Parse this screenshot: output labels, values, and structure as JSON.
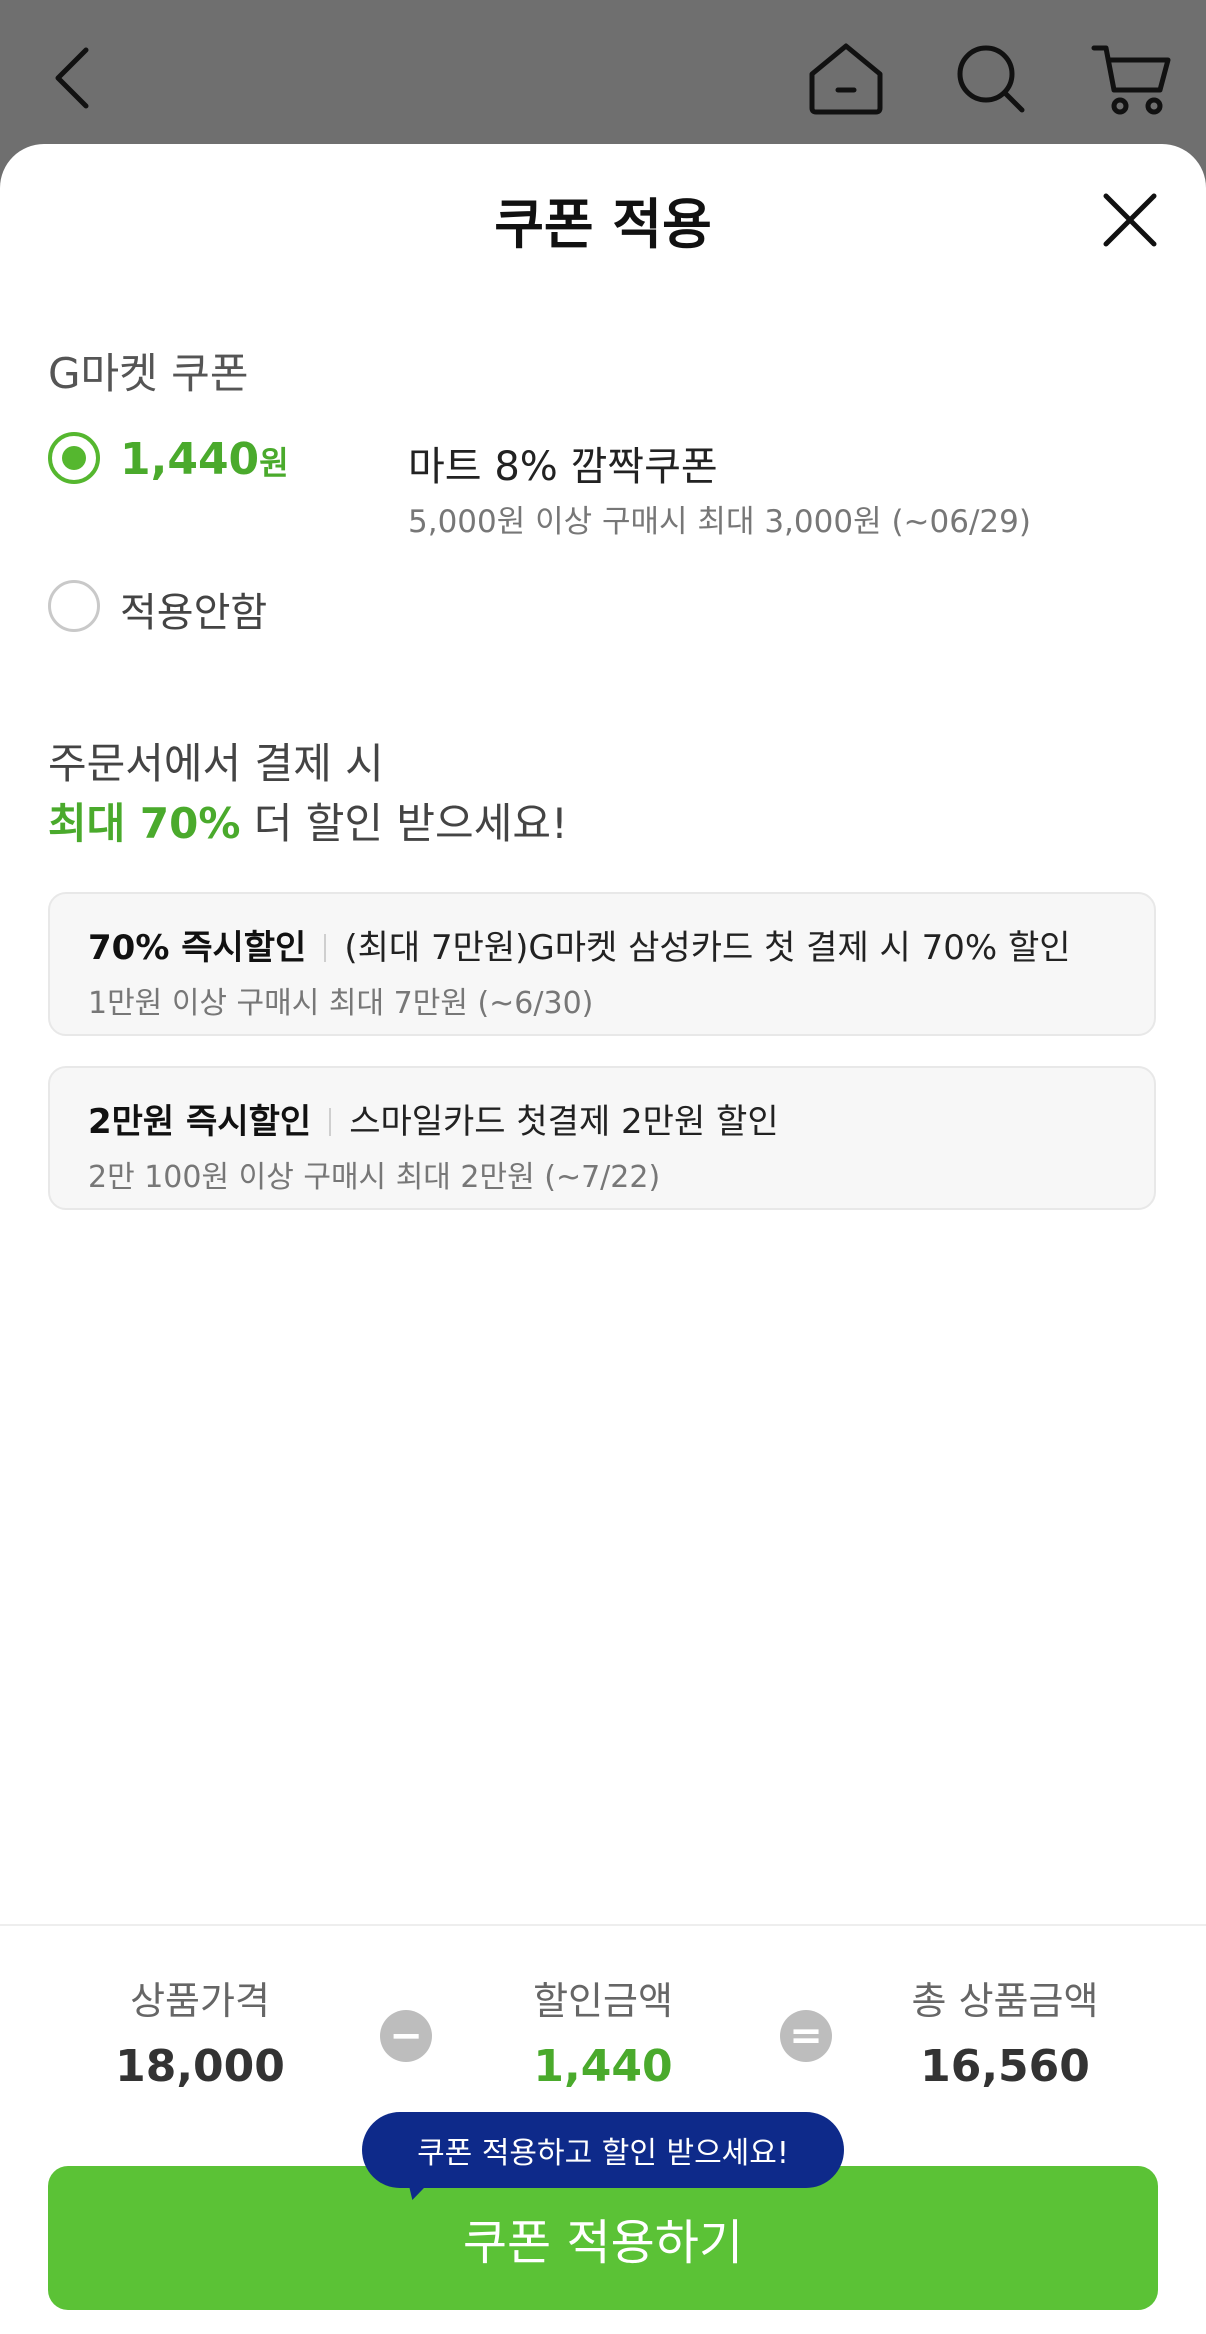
{
  "top_nav": {
    "icons": [
      "back-icon",
      "home-icon",
      "search-icon",
      "cart-icon"
    ]
  },
  "sheet": {
    "title": "쿠폰 적용",
    "close_icon": "close-icon"
  },
  "gmarket_coupons": {
    "section_label": "G마켓 쿠폰",
    "options": [
      {
        "selected": true,
        "amount": "1,440",
        "unit": "원",
        "name": "마트 8% 깜짝쿠폰",
        "condition": "5,000원 이상 구매시 최대 3,000원 (~06/29)"
      },
      {
        "selected": false,
        "label": "적용안함"
      }
    ]
  },
  "promo": {
    "heading_line1": "주문서에서 결제 시",
    "heading_highlight": "최대 70%",
    "heading_rest": " 더 할인 받으세요!",
    "cards": [
      {
        "title": "70% 즉시할인",
        "desc": "(최대 7만원)G마켓 삼성카드 첫 결제 시 70% 할인",
        "condition": "1만원 이상 구매시 최대 7만원 (~6/30)"
      },
      {
        "title": "2만원 즉시할인",
        "desc": "스마일카드 첫결제 2만원 할인",
        "condition": "2만 100원 이상 구매시 최대 2만원 (~7/22)"
      }
    ]
  },
  "summary": {
    "product_price_label": "상품가격",
    "product_price": "18,000",
    "minus": "−",
    "discount_label": "할인금액",
    "discount": "1,440",
    "equals": "=",
    "total_label": "총 상품금액",
    "total": "16,560"
  },
  "cta": {
    "tooltip": "쿠폰 적용하고 할인 받으세요!",
    "button_label": "쿠폰 적용하기"
  },
  "colors": {
    "accent_green": "#5bc236",
    "price_green": "#4aaa2c",
    "tooltip_navy": "#0e2a8a",
    "overlay_gray": "#6f6f6f"
  }
}
